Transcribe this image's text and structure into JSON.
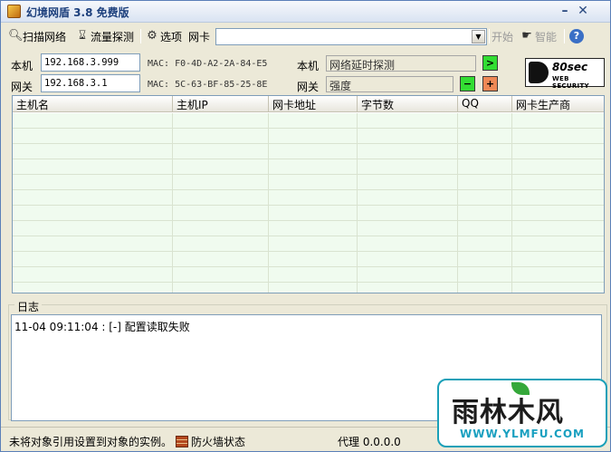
{
  "window": {
    "title": "幻境网盾 3.8 免费版",
    "minimize": "–",
    "close": "✕"
  },
  "toolbar": {
    "scan": "扫描网络",
    "traffic": "流量探测",
    "options": "选项",
    "nic_label": "网卡",
    "nic_value": "",
    "start": "开始",
    "smart": "智能"
  },
  "info": {
    "local_label": "本机",
    "local_ip": "192.168.3.999",
    "local_mac": "MAC: F0-4D-A2-2A-84-E5",
    "gateway_label": "网关",
    "gateway_ip": "192.168.3.1",
    "gateway_mac": "MAC: 5C-63-BF-85-25-8E",
    "right_local_label": "本机",
    "latency_text": "网络延时探测",
    "right_gateway_label": "网关",
    "strength_text": "强度",
    "go_btn": ">",
    "minus_btn": "−",
    "plus_btn": "+"
  },
  "logo": {
    "top": "80sec",
    "bottom": "WEB SECURITY"
  },
  "table": {
    "columns": [
      "主机名",
      "主机IP",
      "网卡地址",
      "字节数",
      "QQ",
      "网卡生产商"
    ],
    "rows": 12
  },
  "log": {
    "label": "日志",
    "entries": [
      "11-04 09:11:04 : [-] 配置读取失败"
    ]
  },
  "status": {
    "message": "未将对象引用设置到对象的实例。",
    "firewall": "防火墙状态",
    "proxy": "代理 0.0.0.0"
  },
  "watermark": {
    "main": "雨林木风",
    "url": "WWW.YLMFU.COM"
  },
  "colors": {
    "go_green": "#33dd33",
    "plus_orange": "#ee8855",
    "grid_row": "#f0fbef",
    "title_text": "#1c3f7c"
  }
}
